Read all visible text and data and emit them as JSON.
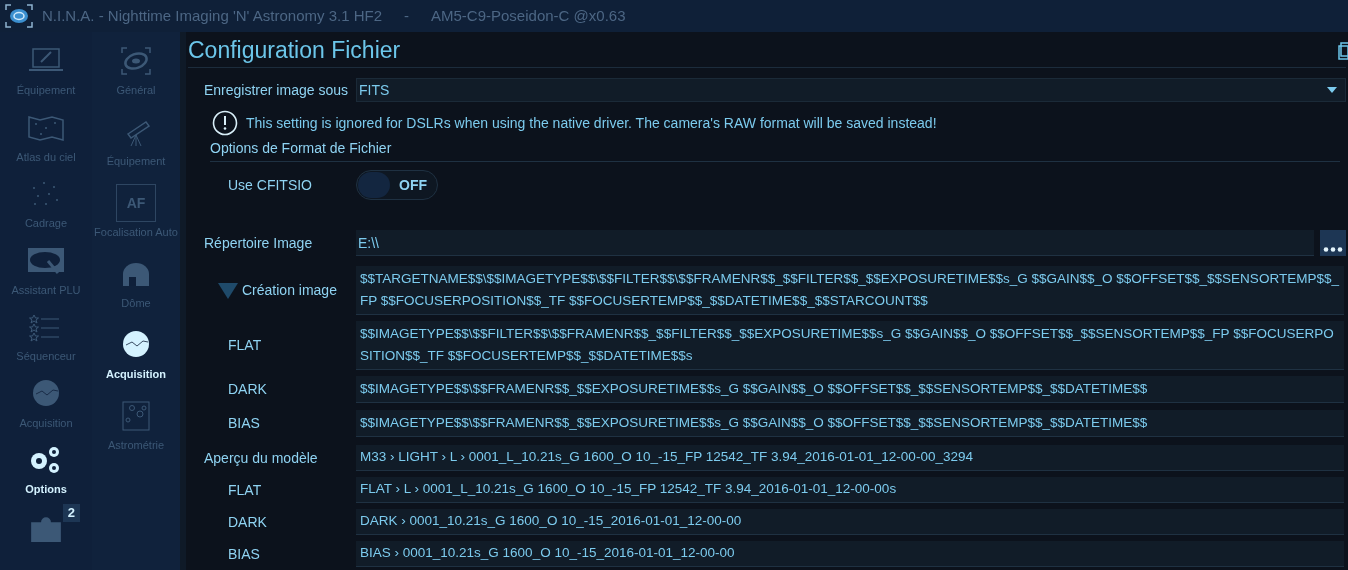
{
  "window": {
    "title": "N.I.N.A. - Nighttime Imaging 'N' Astronomy 3.1 HF2",
    "separator": "-",
    "profile": "AM5-C9-Poseidon-C @x0.63"
  },
  "sidebar": {
    "left": [
      {
        "label": "Équipement",
        "selected": false
      },
      {
        "label": "Atlas du ciel",
        "selected": false
      },
      {
        "label": "Cadrage",
        "selected": false
      },
      {
        "label": "Assistant PLU",
        "selected": false
      },
      {
        "label": "Séquenceur",
        "selected": false
      },
      {
        "label": "Acquisition",
        "selected": false
      },
      {
        "label": "Options",
        "selected": true
      },
      {
        "badge": "2",
        "selected": false
      }
    ],
    "right": [
      {
        "label": "Général",
        "selected": false
      },
      {
        "label": "Équipement",
        "selected": false
      },
      {
        "label": "Focalisation Auto",
        "icon_text": "AF",
        "selected": false
      },
      {
        "label": "Dôme",
        "selected": false
      },
      {
        "label": "Acquisition",
        "selected": true
      },
      {
        "label": "Astrométrie",
        "selected": false
      }
    ]
  },
  "page": {
    "title": "Configuration Fichier",
    "save_format": {
      "label": "Enregistrer image sous",
      "value": "FITS"
    },
    "warning": "This setting is ignored for DSLRs when using the native driver. The camera's RAW format will be saved instead!",
    "format_options": {
      "heading": "Options de Format de Fichier",
      "use_cfitsio": {
        "label": "Use CFITSIO",
        "on": false,
        "state_text": "OFF"
      }
    },
    "image_directory": {
      "label": "Répertoire Image",
      "value": "E:\\\\"
    },
    "patterns": {
      "expanded": true,
      "rows": [
        {
          "label": "Création image",
          "value": "$$TARGETNAME$$\\$$IMAGETYPE$$\\$$FILTER$$\\$$FRAMENR$$_$$FILTER$$_$$EXPOSURETIME$$s_G $$GAIN$$_O $$OFFSET$$_$$SENSORTEMP$$_FP $$FOCUSERPOSITION$$_TF $$FOCUSERTEMP$$_$$DATETIME$$_$$STARCOUNT$$"
        },
        {
          "label": "FLAT",
          "value": "$$IMAGETYPE$$\\$$FILTER$$\\$$FRAMENR$$_$$FILTER$$_$$EXPOSURETIME$$s_G $$GAIN$$_O $$OFFSET$$_$$SENSORTEMP$$_FP $$FOCUSERPOSITION$$_TF $$FOCUSERTEMP$$_$$DATETIME$$s"
        },
        {
          "label": "DARK",
          "value": "$$IMAGETYPE$$\\$$FRAMENR$$_$$EXPOSURETIME$$s_G $$GAIN$$_O $$OFFSET$$_$$SENSORTEMP$$_$$DATETIME$$"
        },
        {
          "label": "BIAS",
          "value": "$$IMAGETYPE$$\\$$FRAMENR$$_$$EXPOSURETIME$$s_G $$GAIN$$_O $$OFFSET$$_$$SENSORTEMP$$_$$DATETIME$$"
        }
      ]
    },
    "preview": {
      "rows": [
        {
          "label": "Aperçu du modèle",
          "value": "M33 › LIGHT › L › 0001_L_10.21s_G 1600_O 10_-15_FP 12542_TF 3.94_2016-01-01_12-00-00_3294"
        },
        {
          "label": "FLAT",
          "value": "FLAT › L › 0001_L_10.21s_G 1600_O 10_-15_FP 12542_TF 3.94_2016-01-01_12-00-00s"
        },
        {
          "label": "DARK",
          "value": "DARK › 0001_10.21s_G 1600_O 10_-15_2016-01-01_12-00-00"
        },
        {
          "label": "BIAS",
          "value": "BIAS › 0001_10.21s_G 1600_O 10_-15_2016-01-01_12-00-00"
        }
      ]
    }
  }
}
